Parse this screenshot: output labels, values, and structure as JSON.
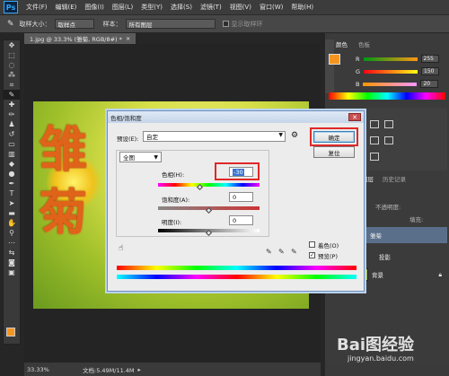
{
  "menubar": {
    "logo": "Ps",
    "items": [
      "文件(F)",
      "编辑(E)",
      "图像(I)",
      "图层(L)",
      "类型(Y)",
      "选择(S)",
      "滤镜(T)",
      "视图(V)",
      "窗口(W)",
      "帮助(H)"
    ]
  },
  "options": {
    "sample_size_label": "取样大小：",
    "sample_size_value": "取样点",
    "sample_label": "样本：",
    "sample_value": "所有图层",
    "show_ring_label": "显示取样环"
  },
  "document": {
    "tab_title": "1.jpg @ 33.3% (雏菊, RGB/8#) *",
    "text_char1": "雏",
    "text_char2": "菊",
    "zoom": "33.33%",
    "doc_info": "文档:5.49M/11.4M"
  },
  "color_panel": {
    "tabs": [
      "颜色",
      "色板"
    ],
    "rows": [
      {
        "label": "R",
        "value": "255"
      },
      {
        "label": "G",
        "value": "150"
      },
      {
        "label": "B",
        "value": "20"
      }
    ],
    "fg_color": "#f5951f"
  },
  "layers_panel": {
    "tabs": [
      "图层",
      "历史记录"
    ],
    "opacity_label": "不透明度:",
    "fill_label": "填充:",
    "layers": [
      "雏菊",
      "投影",
      "背景"
    ]
  },
  "dialog": {
    "title": "色相/饱和度",
    "close": "✕",
    "preset_label": "预设(E):",
    "preset_value": "自定",
    "channel_value": "全图",
    "hue_label": "色相(H):",
    "hue_value": "-30",
    "saturation_label": "饱和度(A):",
    "saturation_value": "0",
    "lightness_label": "明度(I):",
    "lightness_value": "0",
    "ok_label": "确定",
    "reset_label": "复位",
    "colorize_label": "着色(O)",
    "preview_label": "预览(P)",
    "preview_checked": "✓"
  },
  "watermark": {
    "brand": "Bai图经验",
    "url": "jingyan.baidu.com"
  }
}
